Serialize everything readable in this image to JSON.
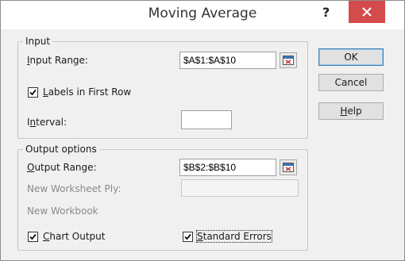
{
  "window": {
    "title": "Moving Average",
    "help_glyph": "?",
    "close_icon": "close-icon"
  },
  "input_group": {
    "legend": "Input",
    "input_range_label": "Input Range:",
    "input_range_value": "$A$1:$A$10",
    "labels_first_row": {
      "label": "Labels in First Row",
      "checked": true
    },
    "interval_label": "Interval:",
    "interval_value": ""
  },
  "output_group": {
    "legend": "Output options",
    "output_range_label": "Output Range:",
    "output_range_value": "$B$2:$B$10",
    "new_worksheet_label": "New Worksheet Ply:",
    "new_worksheet_value": "",
    "new_workbook_label": "New Workbook",
    "chart_output": {
      "label": "Chart Output",
      "checked": true
    },
    "standard_errors": {
      "label": "Standard Errors",
      "checked": true
    }
  },
  "buttons": {
    "ok": "OK",
    "cancel": "Cancel",
    "help": "Help"
  },
  "colors": {
    "close_button": "#d44b4b",
    "dialog_bg": "#f0f0f0",
    "default_button_border": "#3c7fb1"
  }
}
